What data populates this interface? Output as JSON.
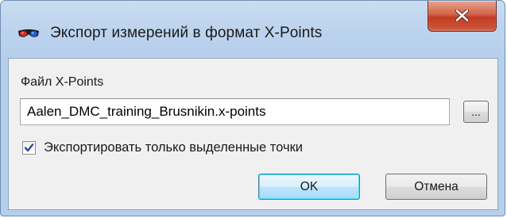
{
  "window": {
    "title": "Экспорт измерений в формат X-Points",
    "app_icon": "stereo-glasses-icon",
    "close_icon": "close-icon"
  },
  "form": {
    "file_label": "Файл X-Points",
    "file_value": "Aalen_DMC_training_Brusnikin.x-points",
    "browse_label": "...",
    "checkbox_label": "Экспортировать только выделенные точки",
    "checkbox_checked": true
  },
  "buttons": {
    "ok_label": "OK",
    "cancel_label": "Отмена"
  },
  "colors": {
    "close_button": "#c23b22",
    "ok_button_border": "#3c7fb1",
    "titlebar": "#bcd3ee"
  }
}
